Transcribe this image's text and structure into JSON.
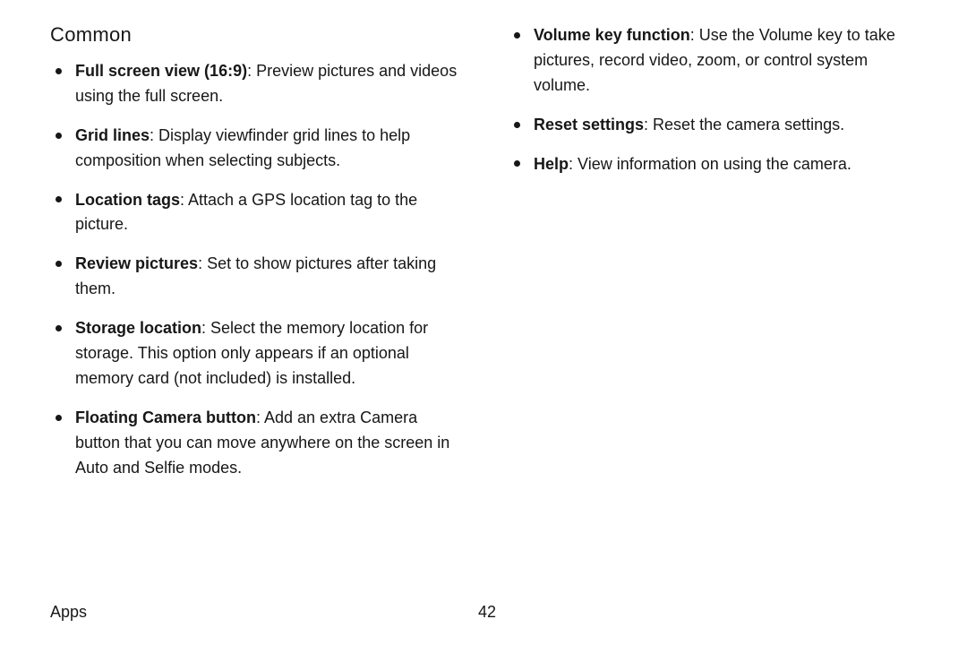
{
  "heading": "Common",
  "left_items": [
    {
      "term": "Full screen view (16:9)",
      "desc": ": Preview pictures and videos using the full screen."
    },
    {
      "term": "Grid lines",
      "desc": ": Display viewfinder grid lines to help composition when selecting subjects."
    },
    {
      "term": "Location tags",
      "desc": ": Attach a GPS location tag to the picture."
    },
    {
      "term": "Review pictures",
      "desc": ": Set to show pictures after taking them."
    },
    {
      "term": "Storage location",
      "desc": ": Select the memory location for storage. This option only appears if an optional memory card (not included) is installed."
    },
    {
      "term": "Floating Camera button",
      "desc": ": Add an extra Camera button that you can move anywhere on the screen in Auto and Selfie modes."
    }
  ],
  "right_items": [
    {
      "term": "Volume key function",
      "desc": ": Use the Volume key to take pictures, record video, zoom, or control system volume."
    },
    {
      "term": "Reset settings",
      "desc": ": Reset the camera settings."
    },
    {
      "term": "Help",
      "desc": ": View information on using the camera."
    }
  ],
  "footer": {
    "section": "Apps",
    "page": "42"
  }
}
